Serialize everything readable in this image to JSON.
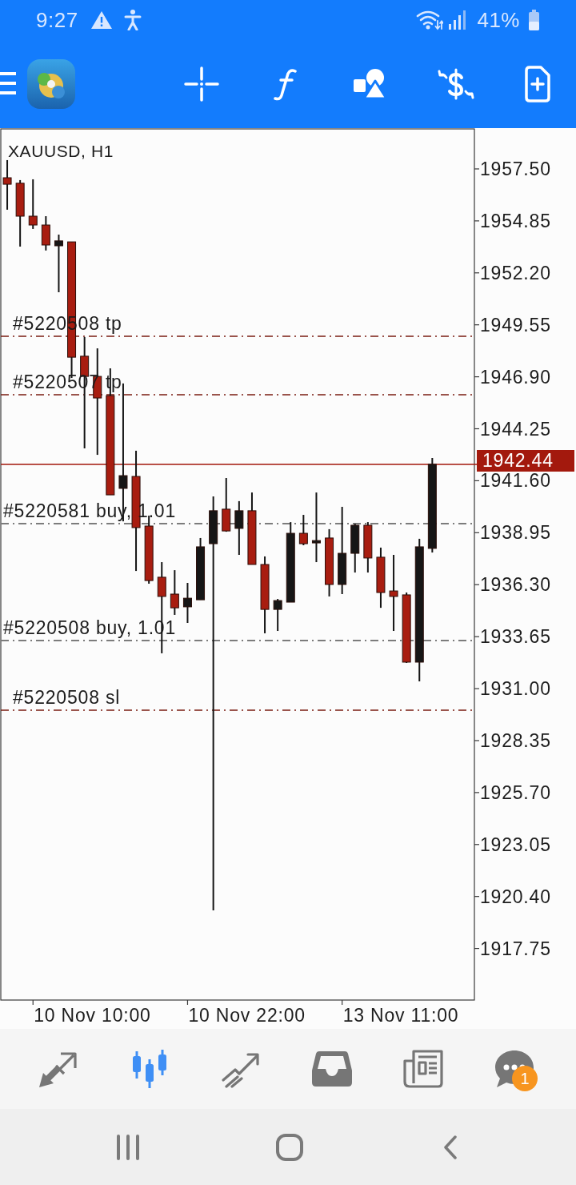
{
  "status_bar": {
    "time": "9:27",
    "battery": "41%"
  },
  "chart": {
    "symbol": "XAUUSD, H1",
    "current_price": "1942.44",
    "order_lines": [
      {
        "kind": "tp",
        "label": "#5220508 tp"
      },
      {
        "kind": "tp",
        "label": "#5220507 tp"
      },
      {
        "kind": "buy",
        "label": "#5220581 buy, 1.01"
      },
      {
        "kind": "buy",
        "label": "#5220508 buy, 1.01"
      },
      {
        "kind": "sl",
        "label": "#5220508 sl"
      }
    ],
    "time_labels": [
      "10 Nov 10:00",
      "10 Nov 22:00",
      "13 Nov 11:00"
    ],
    "chart_data": {
      "type": "candlestick",
      "categories": [
        null,
        null,
        null,
        null,
        null,
        null,
        null,
        null,
        null,
        null,
        null,
        null,
        null,
        null,
        null,
        null,
        null,
        null,
        null,
        null,
        null,
        null,
        null,
        null,
        null,
        null,
        null,
        null,
        null,
        null,
        null,
        null,
        null,
        null
      ],
      "ohlc": [
        [
          1957.05,
          1957.95,
          1955.42,
          1956.72
        ],
        [
          1956.77,
          1956.93,
          1953.54,
          1955.09
        ],
        [
          1955.09,
          1956.97,
          1954.44,
          1954.64
        ],
        [
          1954.64,
          1955.09,
          1953.34,
          1953.62
        ],
        [
          1953.58,
          1954.15,
          1951.21,
          1953.83
        ],
        [
          1953.78,
          1953.78,
          1946.84,
          1947.9
        ],
        [
          1947.95,
          1948.93,
          1943.25,
          1946.92
        ],
        [
          1946.92,
          1948.35,
          1942.92,
          1945.82
        ],
        [
          1945.94,
          1947.33,
          1940.88,
          1940.88
        ],
        [
          1941.21,
          1946.56,
          1939.53,
          1941.86
        ],
        [
          1941.82,
          1943.13,
          1937.0,
          1939.21
        ],
        [
          1939.29,
          1939.82,
          1936.35,
          1936.51
        ],
        [
          1936.68,
          1937.45,
          1932.8,
          1935.7
        ],
        [
          1935.82,
          1937.04,
          1934.76,
          1935.12
        ],
        [
          1935.17,
          1936.39,
          1934.35,
          1935.61
        ],
        [
          1935.53,
          1938.68,
          1935.53,
          1938.23
        ],
        [
          1938.39,
          1940.8,
          1919.69,
          1940.07
        ],
        [
          1940.15,
          1941.74,
          1939.0,
          1939.04
        ],
        [
          1939.17,
          1940.56,
          1937.82,
          1940.07
        ],
        [
          1940.07,
          1941.0,
          1937.33,
          1937.33
        ],
        [
          1937.33,
          1937.74,
          1933.82,
          1935.04
        ],
        [
          1935.04,
          1935.57,
          1933.94,
          1935.49
        ],
        [
          1935.41,
          1939.49,
          1935.41,
          1938.92
        ],
        [
          1938.92,
          1939.86,
          1938.31,
          1938.39
        ],
        [
          1938.43,
          1941.0,
          1937.45,
          1938.55
        ],
        [
          1938.68,
          1939.13,
          1935.7,
          1936.31
        ],
        [
          1936.31,
          1940.27,
          1935.82,
          1937.9
        ],
        [
          1937.9,
          1939.41,
          1936.92,
          1939.33
        ],
        [
          1939.33,
          1939.49,
          1936.92,
          1937.66
        ],
        [
          1937.7,
          1938.19,
          1935.12,
          1935.9
        ],
        [
          1935.98,
          1937.82,
          1933.94,
          1935.7
        ],
        [
          1935.78,
          1935.9,
          1932.31,
          1932.35
        ],
        [
          1932.35,
          1938.64,
          1931.37,
          1938.23
        ],
        [
          1938.15,
          1942.76,
          1937.94,
          1942.44
        ]
      ],
      "ylim": [
        1915.12,
        1959.54
      ],
      "yticks": [
        {
          "value": 1957.5,
          "label": "1957.50"
        },
        {
          "value": 1954.85,
          "label": "1954.85"
        },
        {
          "value": 1952.2,
          "label": "1952.20"
        },
        {
          "value": 1949.55,
          "label": "1949.55"
        },
        {
          "value": 1946.9,
          "label": "1946.90"
        },
        {
          "value": 1944.25,
          "label": "1944.25"
        },
        {
          "value": 1941.6,
          "label": "1941.60"
        },
        {
          "value": 1938.95,
          "label": "1938.95"
        },
        {
          "value": 1936.3,
          "label": "1936.30"
        },
        {
          "value": 1933.65,
          "label": "1933.65"
        },
        {
          "value": 1931.0,
          "label": "1931.00"
        },
        {
          "value": 1928.35,
          "label": "1928.35"
        },
        {
          "value": 1925.7,
          "label": "1925.70"
        },
        {
          "value": 1923.05,
          "label": "1923.05"
        },
        {
          "value": 1920.4,
          "label": "1920.40"
        },
        {
          "value": 1917.75,
          "label": "1917.75"
        }
      ]
    }
  },
  "bottom_nav": {
    "items": [
      {
        "selected": false
      },
      {
        "selected": true
      },
      {
        "selected": false
      },
      {
        "selected": false
      },
      {
        "selected": false
      },
      {
        "selected": false,
        "badge": "1"
      }
    ]
  }
}
